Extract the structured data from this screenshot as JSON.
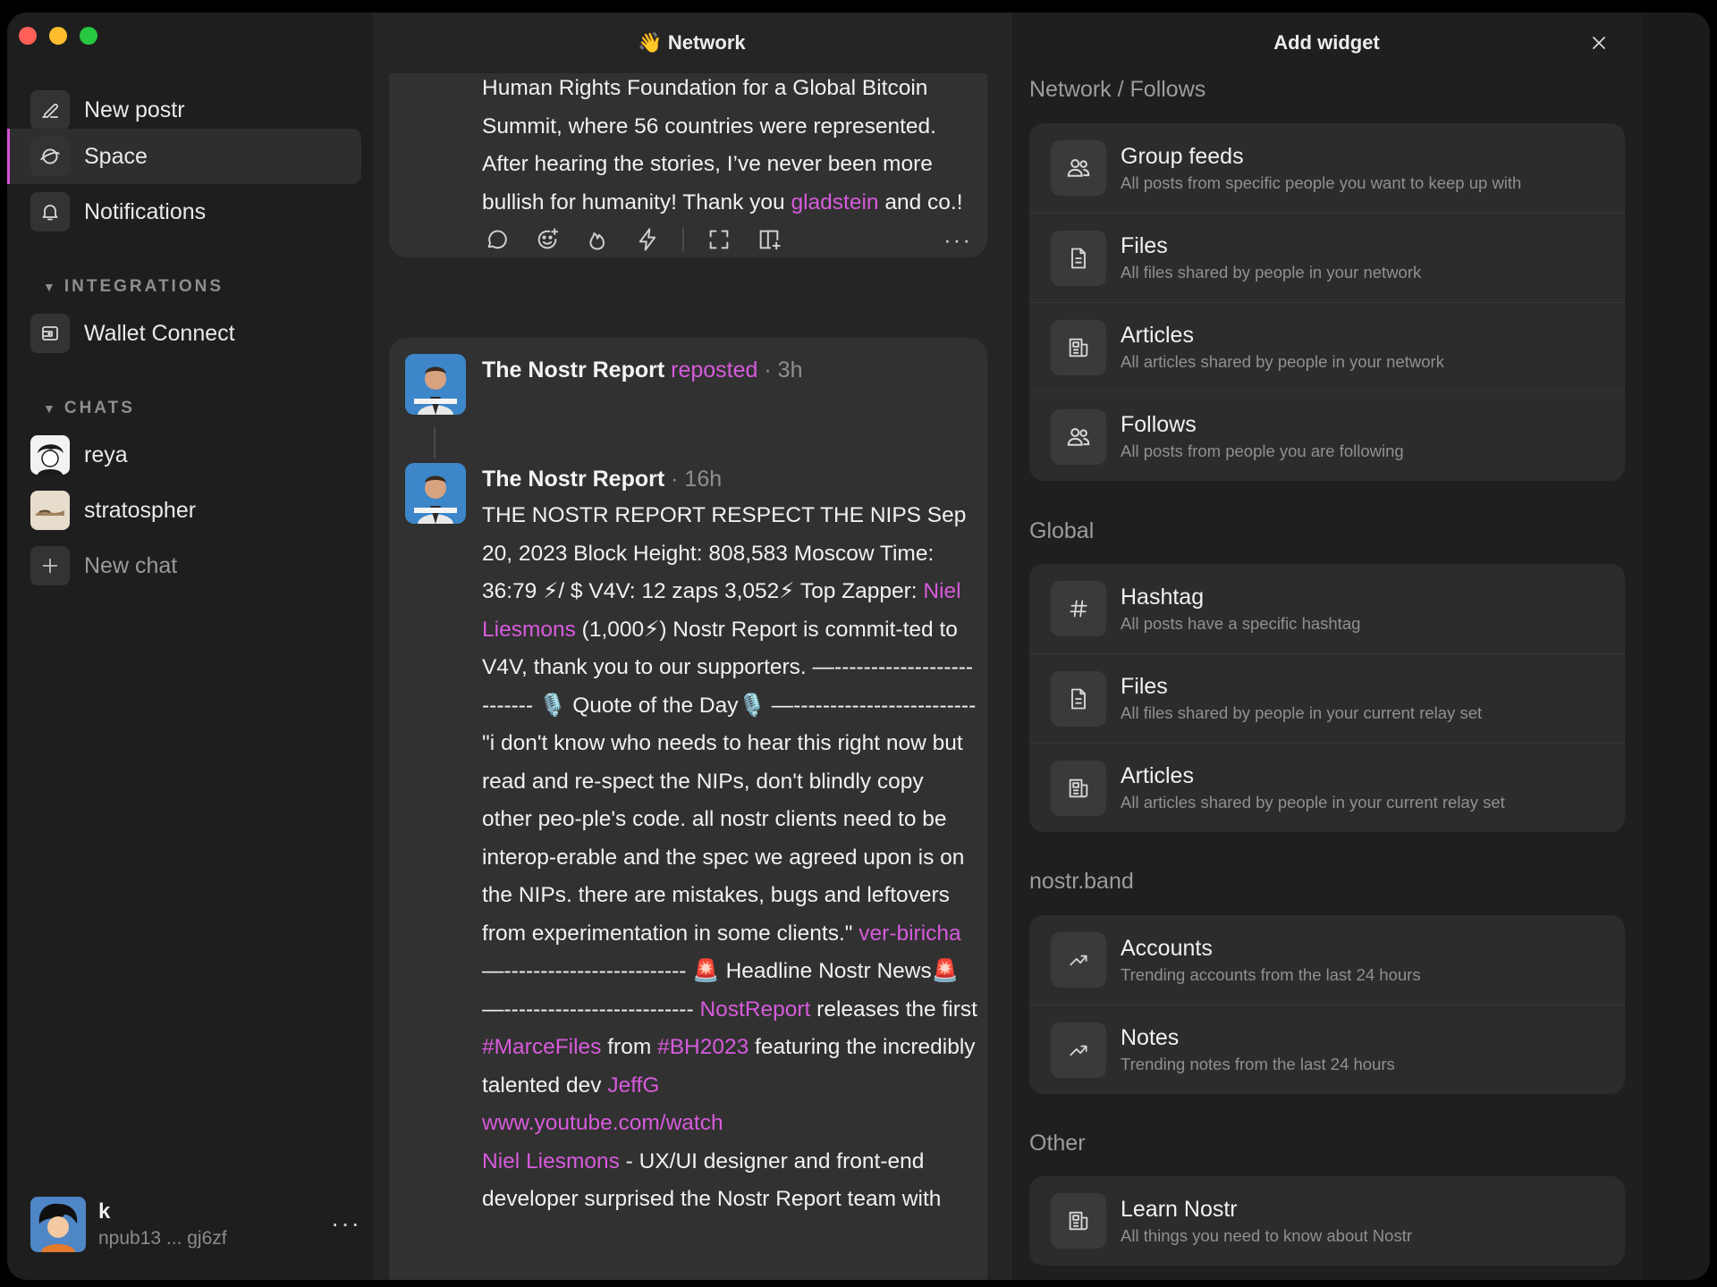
{
  "sidebar": {
    "nav": [
      {
        "label": "New postr",
        "icon": "pencil-icon"
      },
      {
        "label": "Space",
        "icon": "planet-icon"
      },
      {
        "label": "Notifications",
        "icon": "bell-icon"
      }
    ],
    "integrations_title": "INTEGRATIONS",
    "integrations": [
      {
        "label": "Wallet Connect",
        "icon": "wallet-icon"
      }
    ],
    "chats_title": "CHATS",
    "chats": [
      {
        "label": "reya"
      },
      {
        "label": "stratospher"
      }
    ],
    "new_chat": "New chat",
    "user": {
      "name": "k",
      "npub": "npub13 ... gj6zf",
      "more": "···"
    }
  },
  "feed": {
    "title": "👋 Network",
    "post1": {
      "text_a": "Human Rights Foundation for a Global Bitcoin Summit, where 56 countries were represented. After hearing the stories, I’ve never been more bullish for humanity! Thank you ",
      "mention": "gladstein",
      "text_b": " and co.!"
    },
    "post2": {
      "repost_author": "The Nostr Report",
      "repost_label": "reposted",
      "repost_time": "· 3h",
      "author": "The Nostr Report",
      "time": "· 16h",
      "p1": "THE NOSTR REPORT RESPECT THE NIPS Sep 20, 2023 Block Height: 808,583 Moscow Time: 36:79 ⚡/ $ V4V: 12 zaps 3,052⚡ Top Zapper: ",
      "m1": "Niel Liesmons",
      "p2": " (1,000⚡) Nostr Report is commit-ted to V4V, thank you to our supporters. —-------------------------- 🎙️ Quote of the Day🎙️ —------------------------- \"i don't know who needs to hear this right now but read and re-spect the NIPs, don't blindly copy other peo-ple's code. all nostr clients need to be interop-erable and the spec we agreed upon is on the NIPs. there are mistakes, bugs and leftovers from experimentation in some clients.\" ",
      "m2": "ver-biricha",
      "p3": " —------------------------- 🚨 Headline Nostr News🚨 —-------------------------- ",
      "m3": "NostReport",
      "p4": " releases the first ",
      "m4": "#MarceFiles",
      "p5": " from ",
      "m5": "#BH2023",
      "p6": " featuring the incredibly talented dev ",
      "m6": "JeffG",
      "link": "www.youtube.com/watch",
      "m7": "Niel Liesmons",
      "p7": " - UX/UI designer and front-end developer surprised the Nostr Report team with"
    }
  },
  "panel": {
    "title": "Add widget",
    "groups": [
      {
        "title": "Network / Follows",
        "items": [
          {
            "title": "Group feeds",
            "desc": "All posts from specific people you want to keep up with",
            "icon": "users-icon"
          },
          {
            "title": "Files",
            "desc": "All files shared by people in your network",
            "icon": "file-icon"
          },
          {
            "title": "Articles",
            "desc": "All articles shared by people in your network",
            "icon": "article-icon"
          },
          {
            "title": "Follows",
            "desc": "All posts from people you are following",
            "icon": "users-icon"
          }
        ]
      },
      {
        "title": "Global",
        "items": [
          {
            "title": "Hashtag",
            "desc": "All posts have a specific hashtag",
            "icon": "hashtag-icon"
          },
          {
            "title": "Files",
            "desc": "All files shared by people in your current relay set",
            "icon": "file-icon"
          },
          {
            "title": "Articles",
            "desc": "All articles shared by people in your current relay set",
            "icon": "article-icon"
          }
        ]
      },
      {
        "title": "nostr.band",
        "items": [
          {
            "title": "Accounts",
            "desc": "Trending accounts from the last 24 hours",
            "icon": "trending-icon"
          },
          {
            "title": "Notes",
            "desc": "Trending notes from the last 24 hours",
            "icon": "trending-icon"
          }
        ]
      },
      {
        "title": "Other",
        "items": [
          {
            "title": "Learn Nostr",
            "desc": "All things you need to know about Nostr",
            "icon": "article-icon"
          }
        ]
      }
    ]
  },
  "colors": {
    "accent": "#d65bdb",
    "sidebar_bg": "#1e1e1e",
    "feed_bg": "#252525",
    "card_bg": "#313131",
    "panel_bg": "#1f1f1f"
  }
}
